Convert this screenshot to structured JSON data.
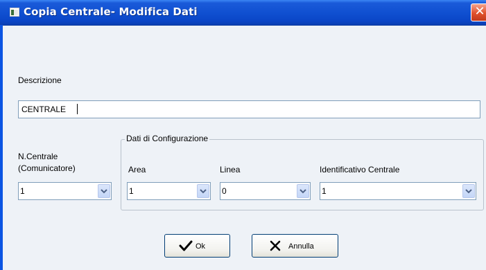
{
  "window": {
    "title": "Copia Centrale- Modifica Dati",
    "close_glyph": "✕"
  },
  "icons": {
    "app": "app-window-icon",
    "close": "close-icon",
    "ok": "checkmark-icon",
    "cancel": "x-icon",
    "dropdown": "chevron-down-icon"
  },
  "form": {
    "descrizione": {
      "label": "Descrizione",
      "value": "CENTRALE"
    },
    "n_centrale": {
      "label_line1": "N.Centrale",
      "label_line2": "(Comunicatore)",
      "value": "1"
    },
    "config_group": {
      "title": "Dati di Configurazione",
      "area": {
        "label": "Area",
        "value": "1"
      },
      "linea": {
        "label": "Linea",
        "value": "0"
      },
      "identificativo": {
        "label": "Identificativo Centrale",
        "value": "1"
      }
    }
  },
  "buttons": {
    "ok": "Ok",
    "annulla": "Annulla"
  },
  "colors": {
    "titlebar": "#0f4fd0",
    "dialog_bg": "#eef2f7",
    "close": "#e1502c",
    "field_border": "#7f9db9"
  }
}
